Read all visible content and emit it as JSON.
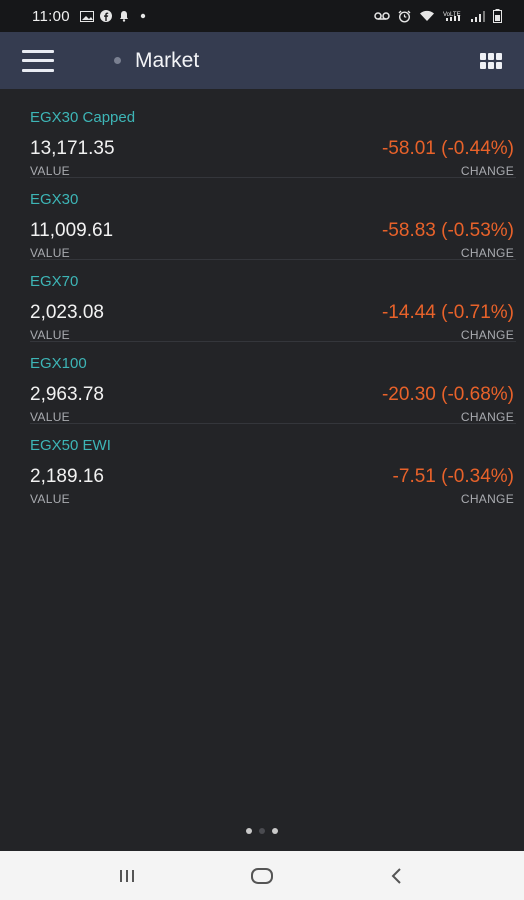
{
  "status_bar": {
    "time": "11:00",
    "left_icons": [
      "image-icon",
      "facebook-icon",
      "notification-icon",
      "dot-icon"
    ],
    "right_icons": [
      "voicemail-icon",
      "alarm-icon",
      "wifi-icon",
      "lte-signal-icon",
      "signal-icon",
      "battery-icon"
    ]
  },
  "app_bar": {
    "title": "Market",
    "menu_icon": "hamburger-menu-icon",
    "view_icon": "grid-view-icon"
  },
  "indices": [
    {
      "name": "EGX30 Capped",
      "value": "13,171.35",
      "change": "-58.01 (-0.44%)",
      "value_label": "VALUE",
      "change_label": "CHANGE"
    },
    {
      "name": "EGX30",
      "value": "11,009.61",
      "change": "-58.83 (-0.53%)",
      "value_label": "VALUE",
      "change_label": "CHANGE"
    },
    {
      "name": "EGX70",
      "value": "2,023.08",
      "change": "-14.44 (-0.71%)",
      "value_label": "VALUE",
      "change_label": "CHANGE"
    },
    {
      "name": "EGX100",
      "value": "2,963.78",
      "change": "-20.30 (-0.68%)",
      "value_label": "VALUE",
      "change_label": "CHANGE"
    },
    {
      "name": "EGX50 EWI",
      "value": "2,189.16",
      "change": "-7.51 (-0.34%)",
      "value_label": "VALUE",
      "change_label": "CHANGE"
    }
  ],
  "pager": {
    "count": 3,
    "active": 0
  },
  "nav_bar": {
    "buttons": [
      "recent-apps-icon",
      "home-icon",
      "back-icon"
    ]
  },
  "colors": {
    "background": "#232427",
    "app_bar": "#353c50",
    "index_name": "#3db5b6",
    "negative_change": "#e8622a"
  }
}
